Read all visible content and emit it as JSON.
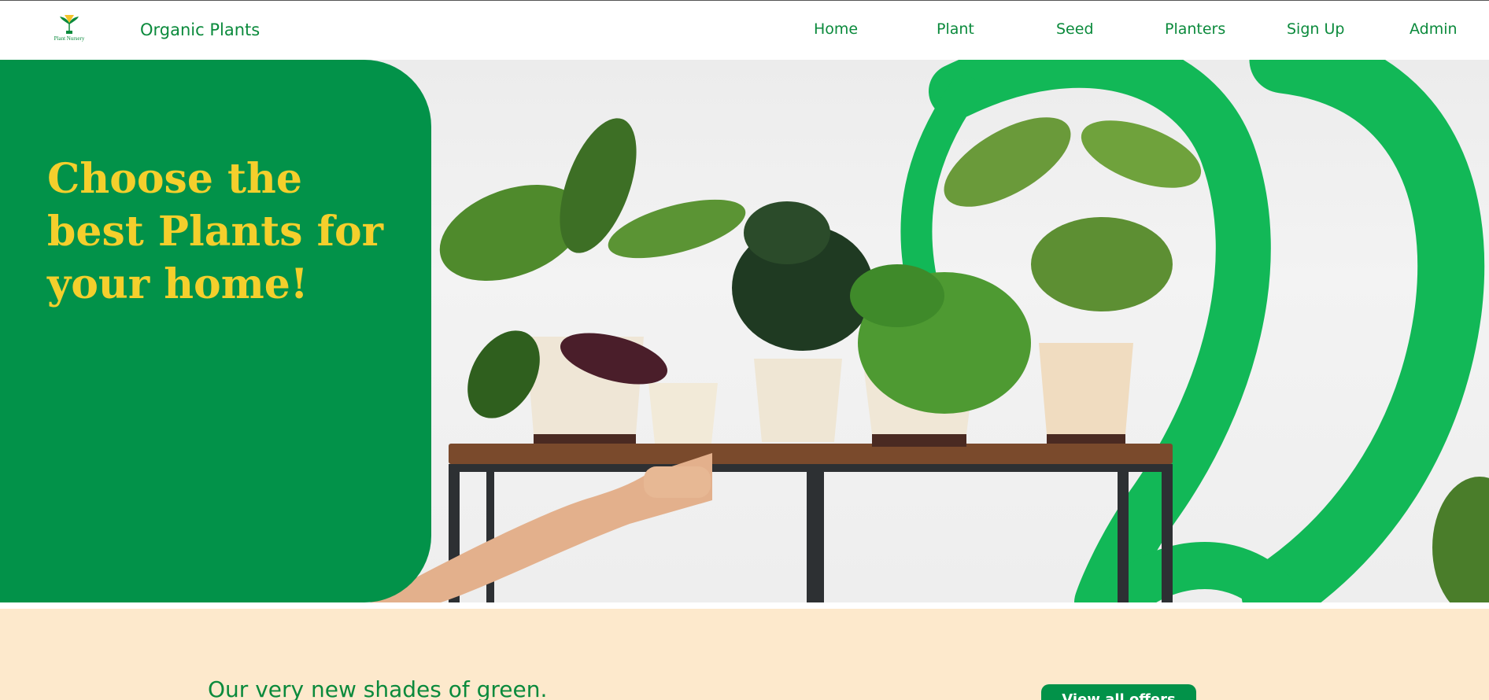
{
  "navbar": {
    "logo_text": "Plant Nursery",
    "brand": "Organic Plants",
    "items": [
      {
        "label": "Home"
      },
      {
        "label": "Plant"
      },
      {
        "label": "Seed"
      },
      {
        "label": "Planters"
      },
      {
        "label": "Sign Up"
      },
      {
        "label": "Admin"
      }
    ]
  },
  "hero": {
    "headline_lines": [
      "Choose the",
      "best Plants for",
      "your home!"
    ]
  },
  "band": {
    "heading": "Our very new shades of green.",
    "button_label": "View all offers"
  },
  "colors": {
    "primary_green": "#029249",
    "headline_yellow": "#f4cf2c",
    "band_background": "#fde9cc",
    "brush_green": "#12b857"
  },
  "icons": {
    "logo": "plant-nursery-logo-icon"
  }
}
